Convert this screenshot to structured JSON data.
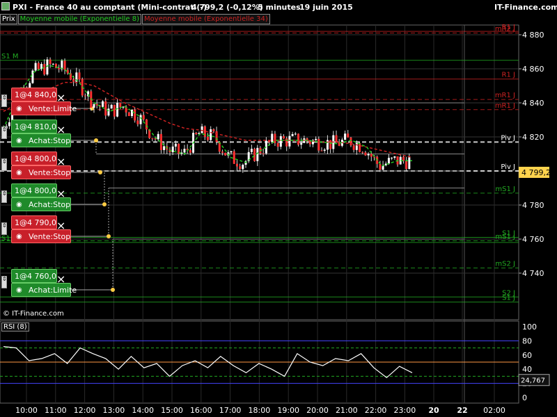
{
  "header": {
    "title": "PXI - France 40 au comptant (Mini-contrat  (-)",
    "price": "4 799,2 (-0,12%)",
    "timeframe": "5 minutes",
    "date": "19 juin 2015",
    "brand": "IT-Finance.com"
  },
  "subheader": {
    "price_tab": "Prix",
    "ma1": "Moyenne mobile (Exponentielle 8)",
    "ma2": "Moyenne mobile (Exponentielle 34)"
  },
  "colors": {
    "ma1": "#22cc22",
    "ma2": "#cc2222",
    "red_order": "#c8202a",
    "green_order": "#1f8a2a",
    "rsi_line": "#ffffff"
  },
  "price_axis": [
    "4 880",
    "4 860",
    "4 840",
    "4 820",
    "4 800",
    "4 780",
    "4 760",
    "4 740"
  ],
  "current_price": "4 799,2",
  "levels": [
    {
      "label": "R1 J",
      "value": 4882,
      "color": "#cc2222"
    },
    {
      "label": "mR2 J",
      "value": 4881,
      "color": "#cc2222"
    },
    {
      "label": "S1 M",
      "value": 4865,
      "color": "#22aa22"
    },
    {
      "label": "R1 J",
      "value": 4854,
      "color": "#cc2222"
    },
    {
      "label": "mR1 J",
      "value": 4842,
      "color": "#cc2222"
    },
    {
      "label": "mR1 J",
      "value": 4836,
      "color": "#cc2222"
    },
    {
      "label": "Piv J",
      "value": 4817,
      "color": "#ffffff"
    },
    {
      "label": "Piv J",
      "value": 4800,
      "color": "#ffffff"
    },
    {
      "label": "mS1 J",
      "value": 4787,
      "color": "#22aa22"
    },
    {
      "label": "S1 J",
      "value": 4761,
      "color": "#22aa22"
    },
    {
      "label": "S1 H",
      "value": 4758,
      "color": "#22aa22"
    },
    {
      "label": "mS1 J",
      "value": 4759,
      "color": "#22aa22"
    },
    {
      "label": "mS2 J",
      "value": 4743,
      "color": "#22aa22"
    },
    {
      "label": "S2 J",
      "value": 4726,
      "color": "#22aa22"
    },
    {
      "label": "S1 J",
      "value": 4723,
      "color": "#22aa22"
    }
  ],
  "orders": [
    {
      "qty": "1@4 840,0",
      "type": "Vente:Limite",
      "side": "sell"
    },
    {
      "qty": "1@4 810,0",
      "type": "Achat:Stop",
      "side": "buy"
    },
    {
      "qty": "1@4 800,0",
      "type": "Vente:Stop",
      "side": "sell"
    },
    {
      "qty": "1@4 800,0",
      "type": "Achat:Stop",
      "side": "buy"
    },
    {
      "qty": "1@4 790,0",
      "type": "Vente:Stop",
      "side": "sell"
    },
    {
      "qty": "1@4 760,0",
      "type": "Achat:Limite",
      "side": "buy"
    }
  ],
  "watermark": "© IT-Finance.com",
  "rsi": {
    "label": "RSI (8)",
    "axis": [
      "100",
      "80",
      "60",
      "40",
      "20",
      "0"
    ],
    "value": "24,767"
  },
  "time_axis": [
    "10:00",
    "11:00",
    "12:00",
    "13:00",
    "14:00",
    "15:00",
    "16:00",
    "17:00",
    "18:00",
    "19:00",
    "20:00",
    "21:00",
    "22:00",
    "23:00",
    "20",
    "22",
    "02:00"
  ],
  "chart_data": {
    "type": "line",
    "title": "PXI - France 40 au comptant (Mini-contrat  (-)",
    "series": [
      {
        "name": "Moyenne mobile (Exponentielle 8)",
        "values": [
          4825,
          4845,
          4858,
          4862,
          4860,
          4852,
          4840,
          4835,
          4838,
          4832,
          4820,
          4812,
          4810,
          4822,
          4820,
          4808,
          4805,
          4812,
          4818,
          4818,
          4818,
          4817,
          4816,
          4818,
          4814,
          4803,
          4806,
          4806
        ]
      },
      {
        "name": "Moyenne mobile (Exponentielle 34)",
        "values": [
          4835,
          4840,
          4845,
          4848,
          4852,
          4852,
          4850,
          4845,
          4840,
          4836,
          4832,
          4828,
          4825,
          4824,
          4822,
          4820,
          4818,
          4818,
          4818,
          4818,
          4818,
          4817,
          4817,
          4816,
          4814,
          4812,
          4810,
          4808
        ]
      },
      {
        "name": "RSI",
        "values": [
          72,
          70,
          52,
          55,
          62,
          48,
          70,
          62,
          55,
          40,
          58,
          42,
          48,
          30,
          45,
          52,
          42,
          58,
          45,
          35,
          48,
          40,
          30,
          62,
          50,
          45,
          55,
          52,
          62,
          42,
          28,
          44,
          35
        ]
      }
    ],
    "ylim": [
      4720,
      4890
    ]
  }
}
